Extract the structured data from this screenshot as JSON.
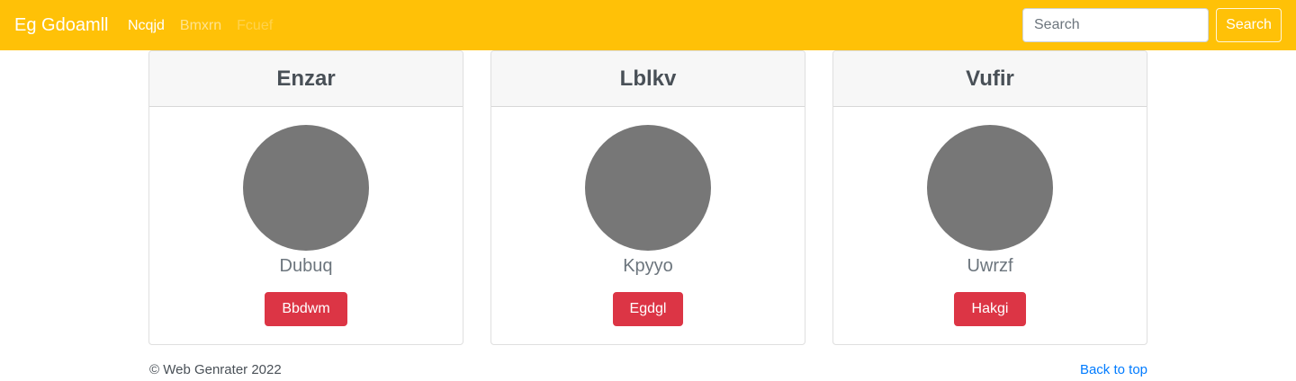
{
  "navbar": {
    "brand": "Eg Gdoamll",
    "links": [
      "Ncqjd",
      "Bmxrn",
      "Fcuef"
    ],
    "search_placeholder": "Search",
    "search_button": "Search",
    "background_color": "#ffc107"
  },
  "cards": [
    {
      "title": "Enzar",
      "text": "Dubuq",
      "button": "Bbdwm »"
    },
    {
      "title": "Lblkv",
      "text": "Kpyyo",
      "button": "Egdgl »"
    },
    {
      "title": "Vufir",
      "text": "Uwrzf",
      "button": "Hakgi »"
    }
  ],
  "footer": {
    "copyright": "© Web Genrater 2022",
    "back_to_top": "Back to top"
  },
  "colors": {
    "button_danger": "#dc3545",
    "avatar": "#777777",
    "link": "#007bff"
  }
}
